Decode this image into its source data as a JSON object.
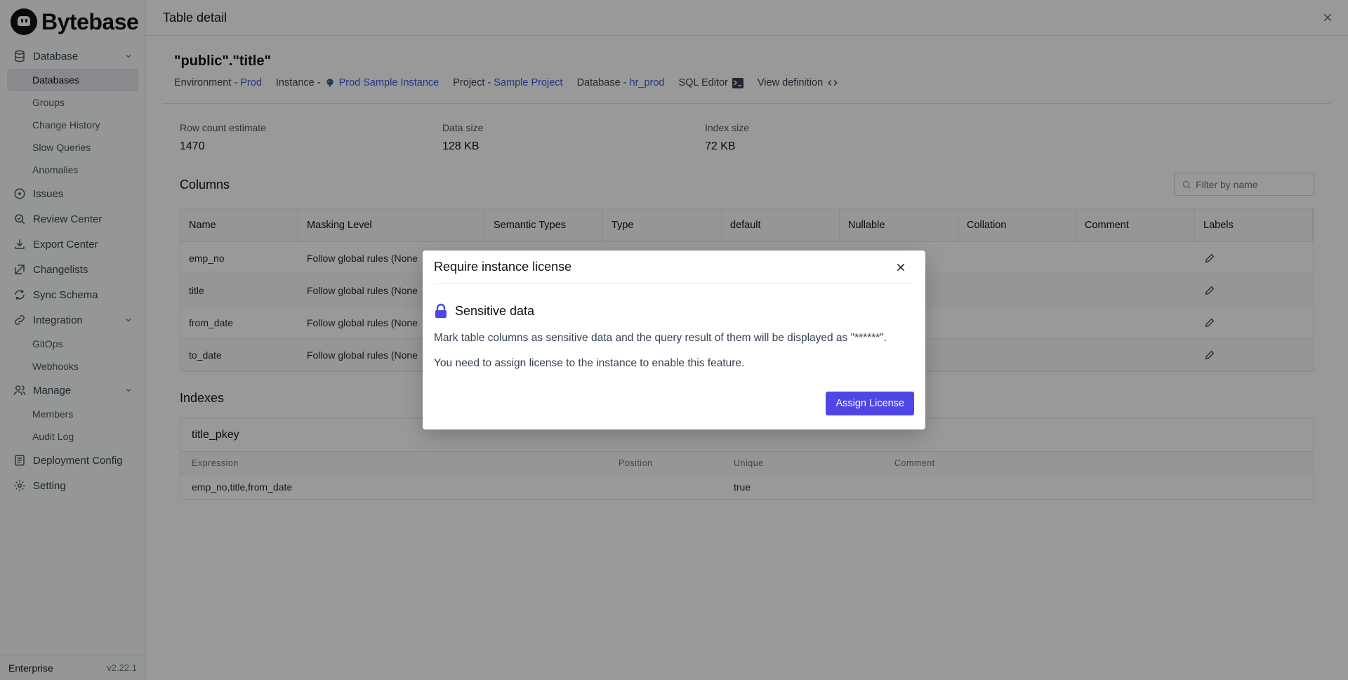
{
  "brand": {
    "name": "Bytebase"
  },
  "sidebar": {
    "items": [
      {
        "label": "Database",
        "icon": "database-icon",
        "expanded": true,
        "children": [
          "Databases",
          "Groups",
          "Change History",
          "Slow Queries",
          "Anomalies"
        ]
      },
      {
        "label": "Issues",
        "icon": "issues-icon"
      },
      {
        "label": "Review Center",
        "icon": "review-icon"
      },
      {
        "label": "Export Center",
        "icon": "download-icon"
      },
      {
        "label": "Changelists",
        "icon": "changelist-icon"
      },
      {
        "label": "Sync Schema",
        "icon": "sync-icon"
      },
      {
        "label": "Integration",
        "icon": "link-icon",
        "expanded": true,
        "children": [
          "GitOps",
          "Webhooks"
        ]
      },
      {
        "label": "Manage",
        "icon": "users-icon",
        "expanded": true,
        "children": [
          "Members",
          "Audit Log"
        ]
      },
      {
        "label": "Deployment Config",
        "icon": "config-icon"
      },
      {
        "label": "Setting",
        "icon": "gear-icon"
      }
    ],
    "active": "Databases",
    "footer": {
      "plan": "Enterprise",
      "version": "v2.22.1"
    }
  },
  "drawer": {
    "title": "Table detail",
    "table_name": "\"public\".\"title\"",
    "meta": {
      "environment_label": "Environment -",
      "environment_value": "Prod",
      "instance_label": "Instance -",
      "instance_value": "Prod Sample Instance",
      "project_label": "Project -",
      "project_value": "Sample Project",
      "database_label": "Database -",
      "database_value": "hr_prod",
      "sql_editor": "SQL Editor",
      "view_definition": "View definition"
    },
    "stats": [
      {
        "label": "Row count estimate",
        "value": "1470"
      },
      {
        "label": "Data size",
        "value": "128 KB"
      },
      {
        "label": "Index size",
        "value": "72 KB"
      }
    ],
    "columns_title": "Columns",
    "filter_placeholder": "Filter by name",
    "columns_headers": [
      "Name",
      "Masking Level",
      "Semantic Types",
      "Type",
      "default",
      "Nullable",
      "Collation",
      "Comment",
      "Labels"
    ],
    "columns_rows": [
      {
        "name": "emp_no",
        "masking": "Follow global rules (None"
      },
      {
        "name": "title",
        "masking": "Follow global rules (None"
      },
      {
        "name": "from_date",
        "masking": "Follow global rules (None"
      },
      {
        "name": "to_date",
        "masking": "Follow global rules (None"
      }
    ],
    "indexes_title": "Indexes",
    "index": {
      "name": "title_pkey",
      "headers": [
        "Expression",
        "Position",
        "Unique",
        "Comment"
      ],
      "row": {
        "expression": "emp_no,title,from_date",
        "position": "",
        "unique": "true",
        "comment": ""
      }
    }
  },
  "modal": {
    "title": "Require instance license",
    "feature": "Sensitive data",
    "description": "Mark table columns as sensitive data and the query result of them will be displayed as \"******\".",
    "hint": "You need to assign license to the instance to enable this feature.",
    "button": "Assign License"
  },
  "colors": {
    "accent": "#4f46e5",
    "link": "#3b5bdb",
    "overlay": "rgba(0,0,0,0.4)"
  }
}
